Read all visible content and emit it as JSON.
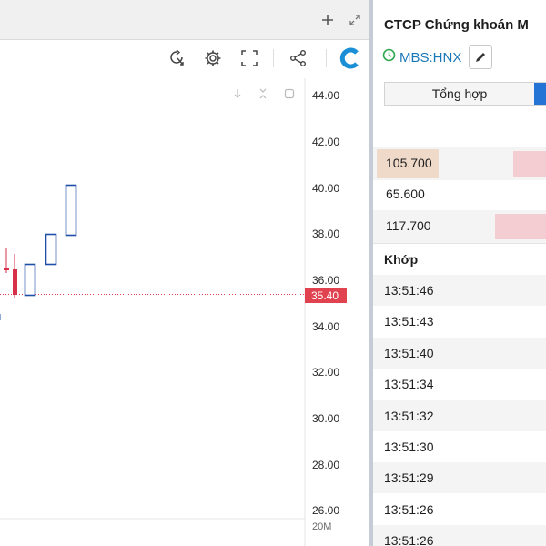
{
  "chart": {
    "price_axis": [
      "44.00",
      "42.00",
      "40.00",
      "38.00",
      "36.00",
      "34.00",
      "32.00",
      "30.00",
      "28.00",
      "26.00"
    ],
    "current_price_label": "35.40",
    "volume_axis_label": "20M",
    "colors": {
      "up": "#1f4fa8",
      "down": "#d9304a",
      "price_line": "#e0434f"
    }
  },
  "toolbar": {
    "icons": [
      "crosshair-refresh-icon",
      "gear-icon",
      "fullscreen-icon",
      "share-icon",
      "logo-c-icon"
    ]
  },
  "info": {
    "company": "CTCP Chứng khoán M",
    "ticker": "MBS:HNX",
    "tab_summary": "Tổng hợp",
    "price_rows": [
      "105.700",
      "65.600",
      "117.700"
    ],
    "trades_header": "Khớp",
    "trade_times": [
      "13:51:46",
      "13:51:43",
      "13:51:40",
      "13:51:34",
      "13:51:32",
      "13:51:30",
      "13:51:29",
      "13:51:26",
      "13:51:26"
    ]
  }
}
